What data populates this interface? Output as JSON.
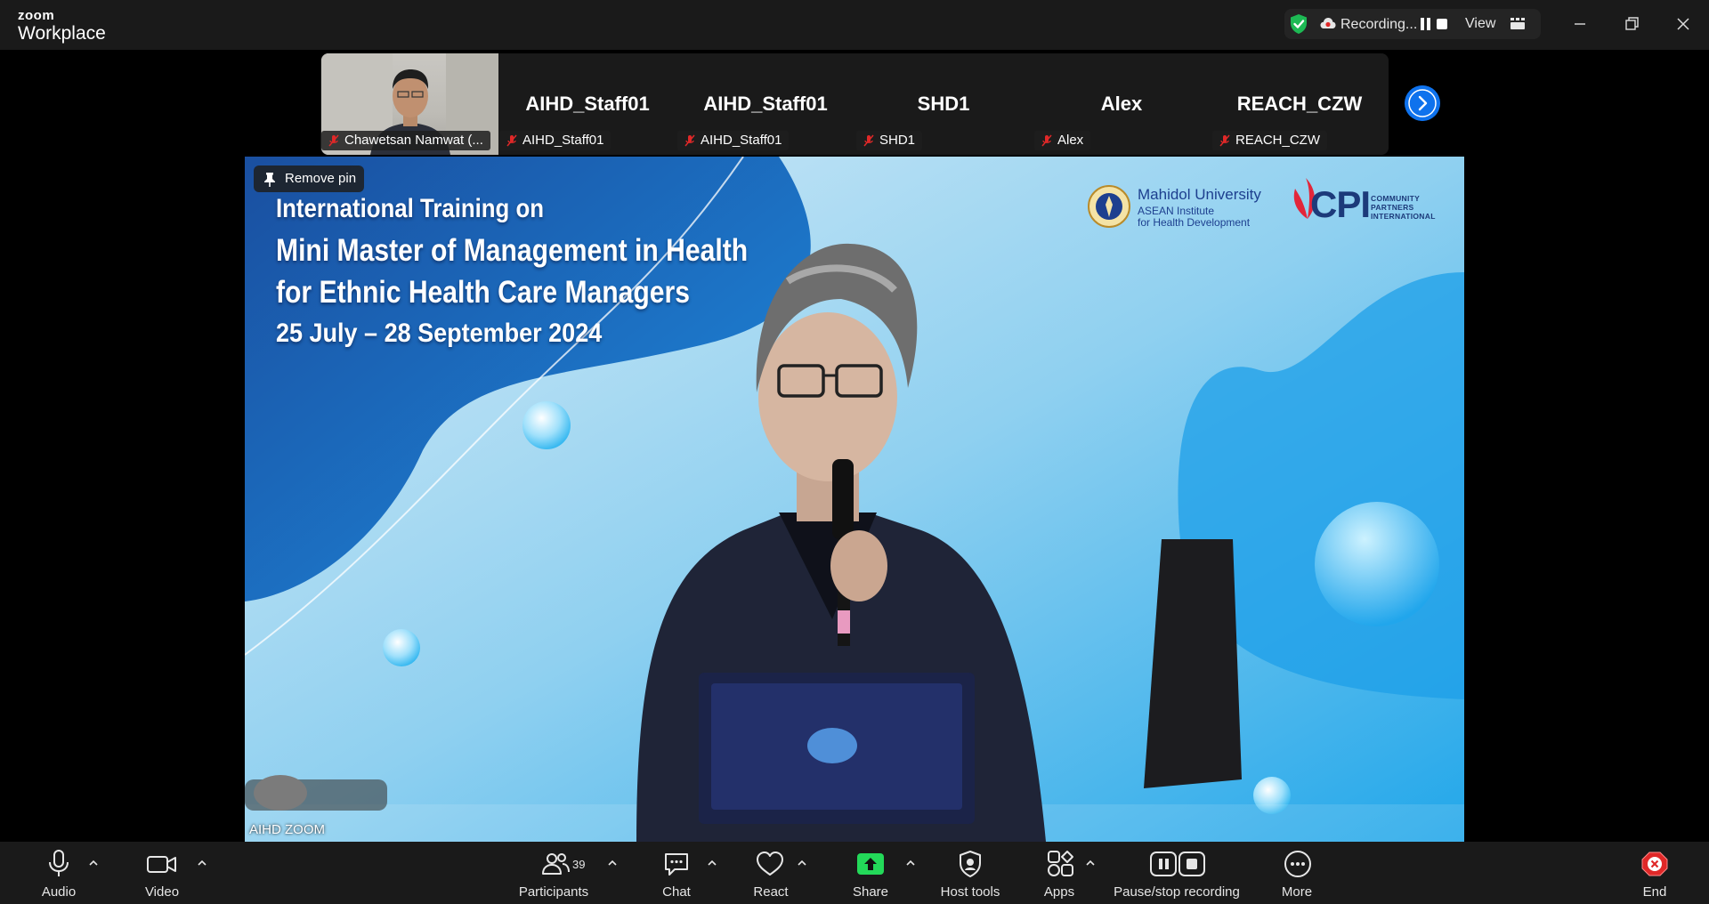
{
  "app": {
    "logo_top": "zoom",
    "logo_bottom": "Workplace"
  },
  "titlebar": {
    "recording_label": "Recording...",
    "view_label": "View",
    "colors": {
      "shield": "#1db954",
      "bar": "#1a1a1a"
    },
    "icons": [
      "shield-check-icon",
      "cloud-icon",
      "pause-icon",
      "stop-icon",
      "gallery-grid-icon",
      "minimize-icon",
      "restore-icon",
      "close-icon"
    ]
  },
  "participants_strip": [
    {
      "display": "video",
      "caption": "Chawetsan Namwat (..."
    },
    {
      "display": "name",
      "name": "AIHD_Staff01",
      "caption": "AIHD_Staff01"
    },
    {
      "display": "name",
      "name": "AIHD_Staff01",
      "caption": "AIHD_Staff01"
    },
    {
      "display": "name",
      "name": "SHD1",
      "caption": "SHD1"
    },
    {
      "display": "name",
      "name": "Alex",
      "caption": "Alex"
    },
    {
      "display": "name",
      "name": "REACH_CZW",
      "caption": "REACH_CZW"
    }
  ],
  "main_video": {
    "pin_button": "Remove pin",
    "label": "AIHD ZOOM",
    "slide": {
      "line1": "International Training on",
      "line2": "Mini Master of Management in Health",
      "line3": "for Ethnic Health Care Managers",
      "line4": "25 July – 28 September 2024",
      "mahidol_name": "Mahidol University",
      "mahidol_sub1": "ASEAN Institute",
      "mahidol_sub2": "for Health Development",
      "cpi": "CPI",
      "cpi_sub1": "COMMUNITY",
      "cpi_sub2": "PARTNERS",
      "cpi_sub3": "INTERNATIONAL"
    }
  },
  "toolbar": {
    "audio": "Audio",
    "video": "Video",
    "participants": "Participants",
    "participants_count": "39",
    "chat": "Chat",
    "react": "React",
    "share": "Share",
    "host_tools": "Host tools",
    "apps": "Apps",
    "pause_stop": "Pause/stop recording",
    "more": "More",
    "end": "End",
    "colors": {
      "share": "#23d959",
      "end": "#e02828"
    }
  }
}
